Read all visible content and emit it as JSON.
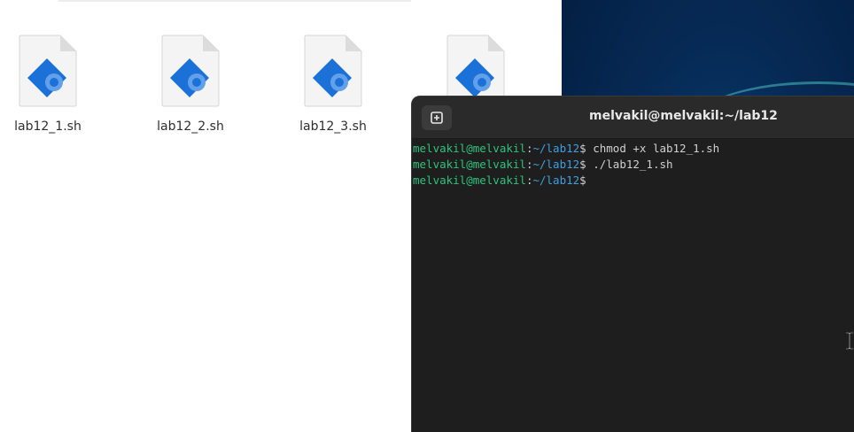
{
  "file_manager": {
    "files": [
      {
        "name": "lab12_1.sh"
      },
      {
        "name": "lab12_2.sh"
      },
      {
        "name": "lab12_3.sh"
      },
      {
        "name": ""
      }
    ],
    "icon": "shell-script-file-icon"
  },
  "terminal": {
    "title": "melvakil@melvakil:~/lab12",
    "new_tab_icon": "new-tab-icon",
    "lines": [
      {
        "user": "melvakil@melvakil",
        "colon": ":",
        "path": "~/lab12",
        "prompt": "$ ",
        "command": "chmod +x lab12_1.sh"
      },
      {
        "user": "melvakil@melvakil",
        "colon": ":",
        "path": "~/lab12",
        "prompt": "$ ",
        "command": "./lab12_1.sh"
      },
      {
        "user": "melvakil@melvakil",
        "colon": ":",
        "path": "~/lab12",
        "prompt": "$",
        "command": ""
      }
    ]
  },
  "colors": {
    "terminal_bg": "#1e1e1e",
    "prompt_user": "#2ec27e",
    "prompt_path": "#3f9fe0",
    "file_icon_blue": "#1c71d8"
  },
  "cursor_icon": "text-cursor-icon"
}
